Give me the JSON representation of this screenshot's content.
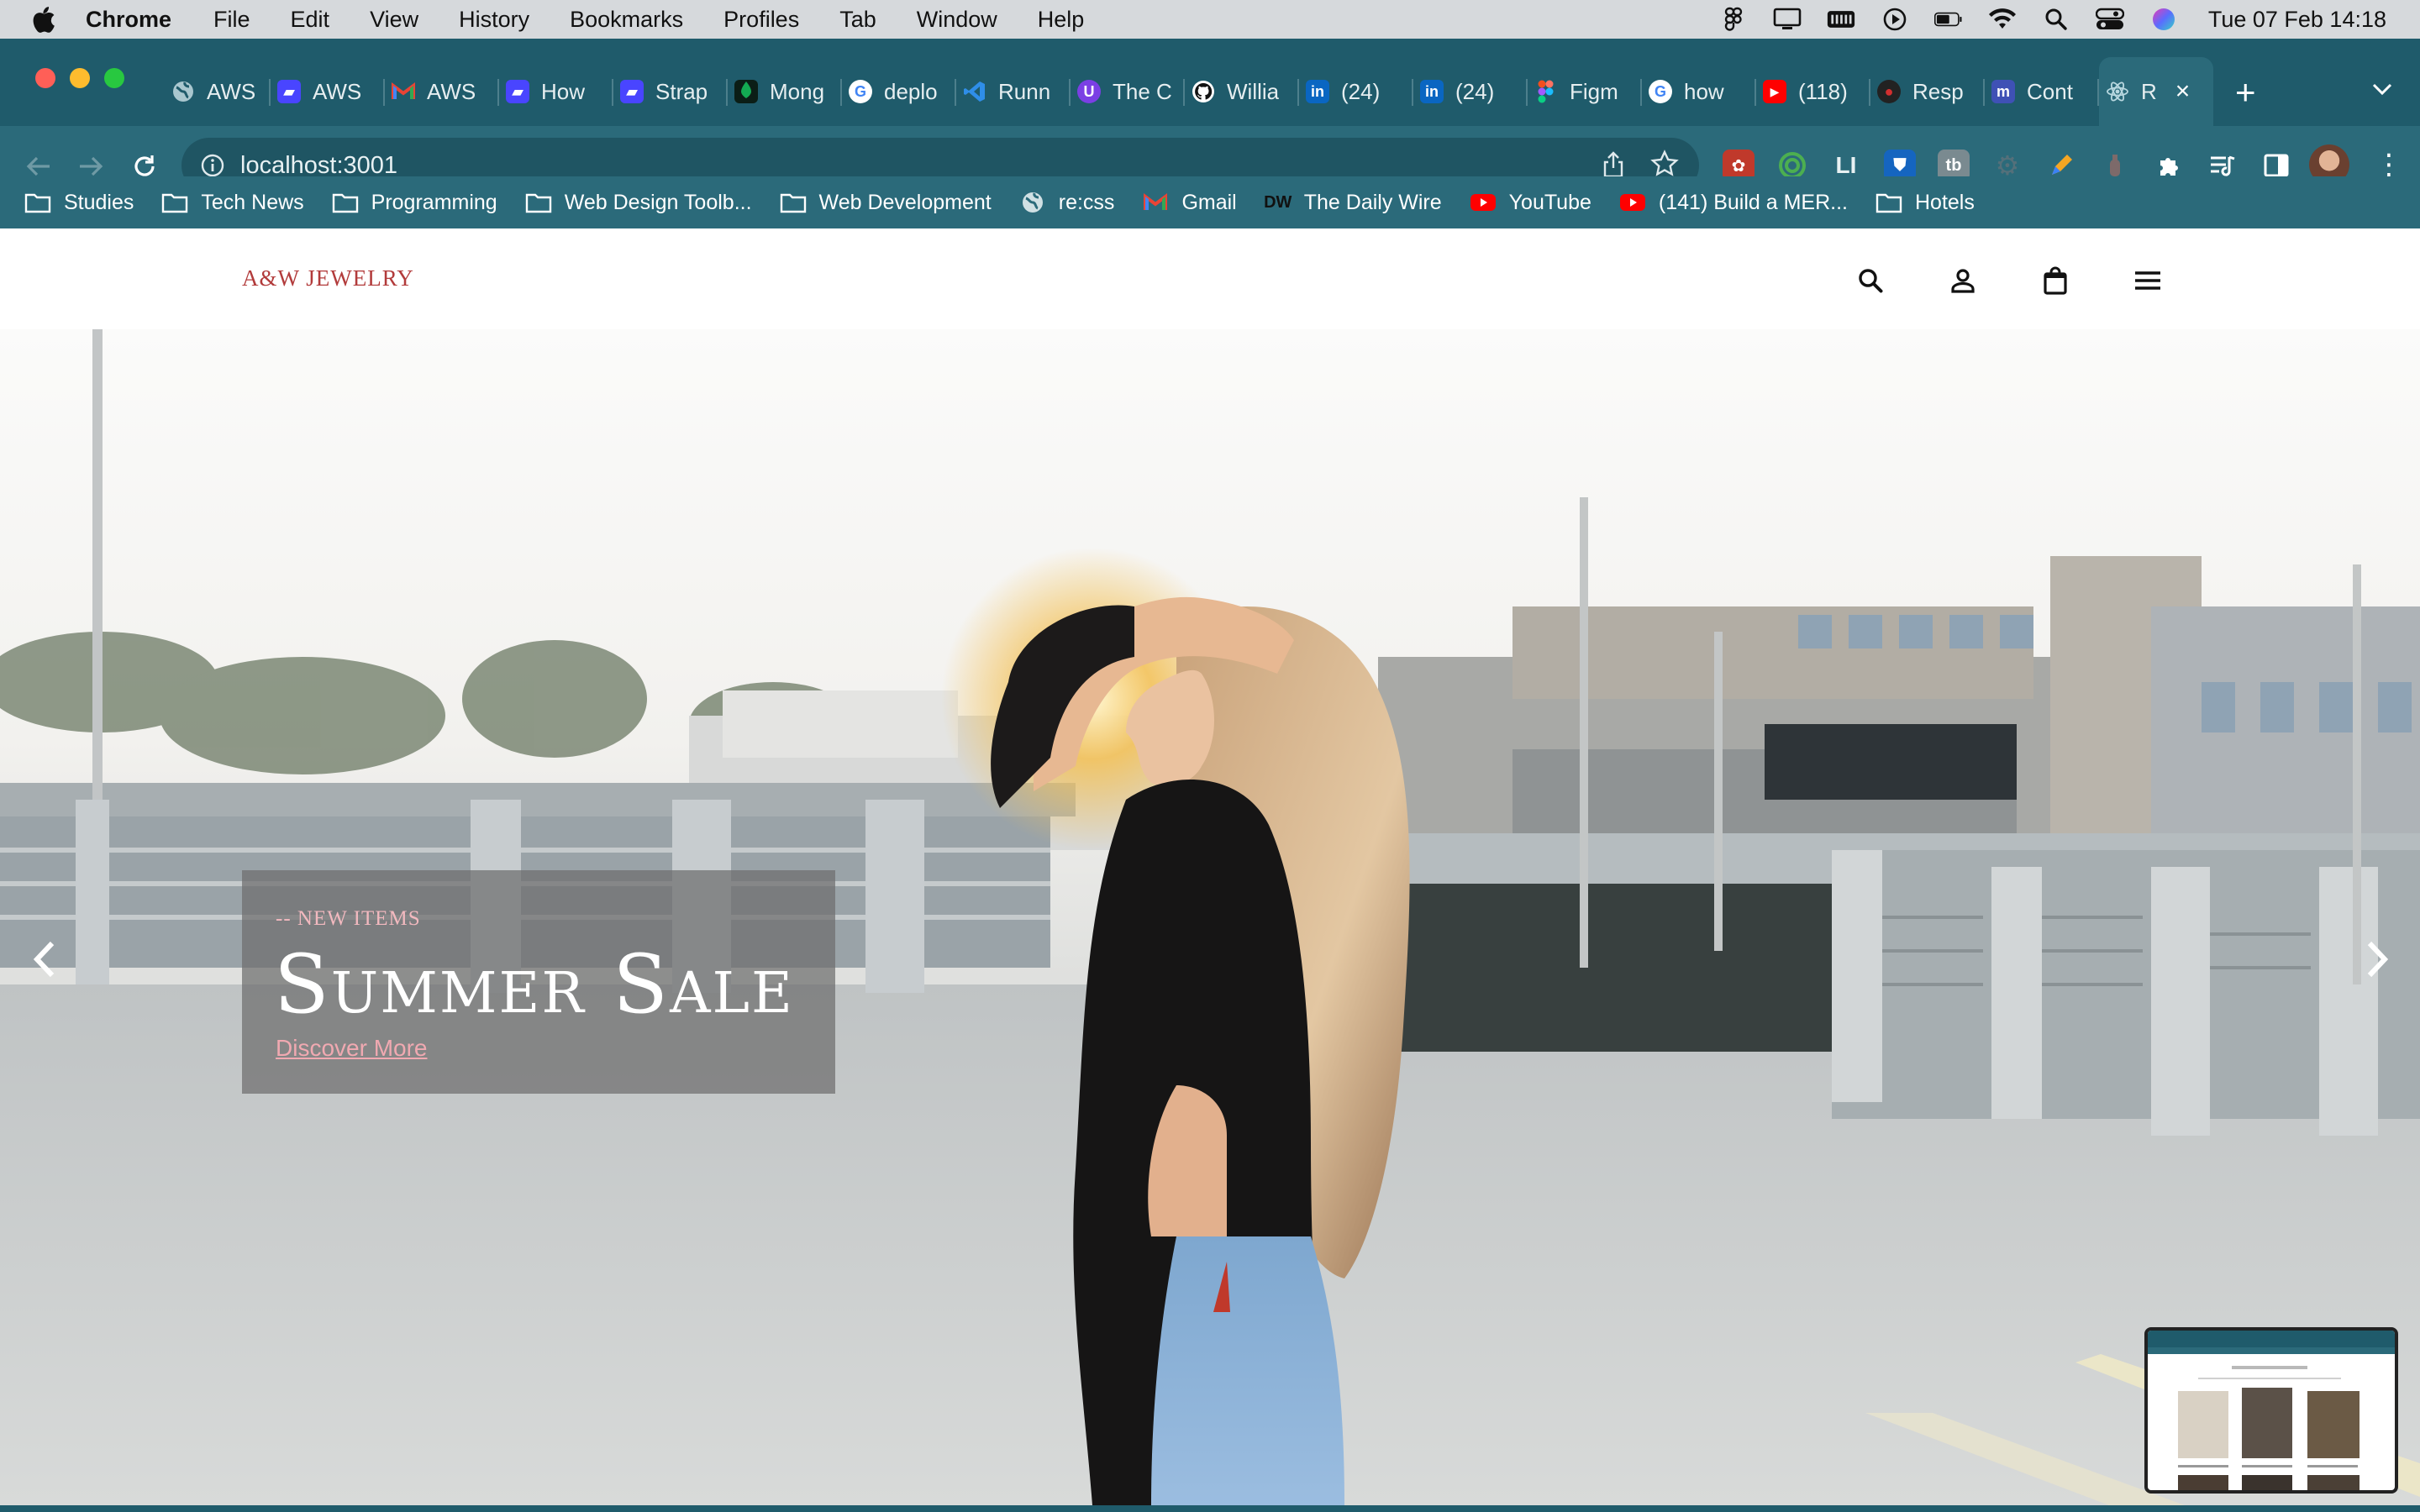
{
  "menubar": {
    "app": "Chrome",
    "items": [
      "File",
      "Edit",
      "View",
      "History",
      "Bookmarks",
      "Profiles",
      "Tab",
      "Window",
      "Help"
    ],
    "clock": "Tue 07 Feb  14:18"
  },
  "tabs": [
    {
      "title": "AWS",
      "icon": "globe-icon",
      "color": "#5f8f9c"
    },
    {
      "title": "AWS",
      "icon": "strapi-icon",
      "color": "#4945ff"
    },
    {
      "title": "AWS",
      "icon": "gmail-icon",
      "color": "#ea4335"
    },
    {
      "title": "How",
      "icon": "strapi-icon",
      "color": "#4945ff"
    },
    {
      "title": "Strap",
      "icon": "strapi-icon",
      "color": "#4945ff"
    },
    {
      "title": "Mong",
      "icon": "mongodb-icon",
      "color": "#13aa52"
    },
    {
      "title": "deplo",
      "icon": "google-icon",
      "color": "#ffffff"
    },
    {
      "title": "Runn",
      "icon": "vscode-icon",
      "color": "#2f80ed"
    },
    {
      "title": "The C",
      "icon": "purple-icon",
      "color": "#7b3fe4"
    },
    {
      "title": "Willia",
      "icon": "github-icon",
      "color": "#111111"
    },
    {
      "title": "(24)",
      "icon": "linkedin-icon",
      "color": "#0a66c2"
    },
    {
      "title": "(24)",
      "icon": "linkedin-icon",
      "color": "#0a66c2"
    },
    {
      "title": "Figm",
      "icon": "figma-icon",
      "color": "#f24e1e"
    },
    {
      "title": "how",
      "icon": "google-icon",
      "color": "#ffffff"
    },
    {
      "title": "(118)",
      "icon": "youtube-icon",
      "color": "#ff0000"
    },
    {
      "title": "Resp",
      "icon": "spy-icon",
      "color": "#d32f2f"
    },
    {
      "title": "Cont",
      "icon": "m-icon",
      "color": "#3f51b5"
    },
    {
      "title": "R",
      "icon": "react-icon",
      "color": "#61dafb",
      "active": true
    }
  ],
  "address": {
    "url": "localhost:3001"
  },
  "bookmarks": [
    {
      "label": "Studies",
      "icon": "folder-icon"
    },
    {
      "label": "Tech News",
      "icon": "folder-icon"
    },
    {
      "label": "Programming",
      "icon": "folder-icon"
    },
    {
      "label": "Web Design Toolb...",
      "icon": "folder-icon"
    },
    {
      "label": "Web Development",
      "icon": "folder-icon"
    },
    {
      "label": "re:css",
      "icon": "globe-icon"
    },
    {
      "label": "Gmail",
      "icon": "gmail-icon"
    },
    {
      "label": "The Daily Wire",
      "icon": "dw-icon"
    },
    {
      "label": "YouTube",
      "icon": "youtube-icon"
    },
    {
      "label": "(141) Build a MER...",
      "icon": "youtube-icon"
    },
    {
      "label": "Hotels",
      "icon": "folder-icon"
    }
  ],
  "site": {
    "logo": "A&W JEWELRY",
    "hero": {
      "eyebrow": "-- NEW ITEMS",
      "title": "Summer Sale",
      "cta": "Discover More"
    }
  },
  "colors": {
    "chrome_dark": "#1f5b6b",
    "chrome_light": "#2b6a7a",
    "logo": "#b23b3b",
    "cta": "#f0a9b1"
  }
}
